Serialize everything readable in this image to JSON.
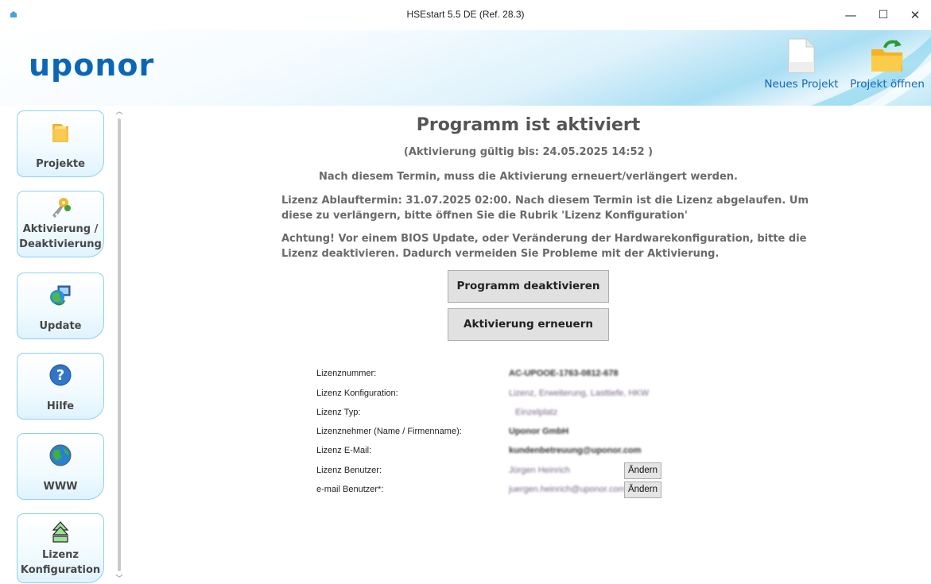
{
  "window": {
    "title": "HSEstart 5.5 DE (Ref. 28.3)",
    "minimize": "—",
    "maximize": "☐",
    "close": "✕"
  },
  "header": {
    "logo": "uponor",
    "new_project": "Neues Projekt",
    "open_project": "Projekt öffnen"
  },
  "sidebar": {
    "items": [
      {
        "label": "Projekte",
        "icon": "folder-icon"
      },
      {
        "label": "Aktivierung / Deaktivierung",
        "icon": "keys-icon"
      },
      {
        "label": "Update",
        "icon": "update-icon"
      },
      {
        "label": "Hilfe",
        "icon": "help-icon"
      },
      {
        "label": "WWW",
        "icon": "globe-icon"
      },
      {
        "label": "Lizenz Konfiguration",
        "icon": "license-config-icon"
      }
    ]
  },
  "main": {
    "heading": "Programm ist aktiviert",
    "validity": "(Aktivierung gültig bis: 24.05.2025 14:52 )",
    "renew_notice": "Nach diesem Termin, muss die Aktivierung erneuert/verlängert werden.",
    "license_expiry_1": "Lizenz Ablauftermin: 31.07.2025 02:00. Nach diesem Termin ist die Lizenz abgelaufen. Um",
    "license_expiry_2": "diese zu verlängern, bitte öffnen Sie die Rubrik 'Lizenz Konfiguration'",
    "warning_1": "Achtung! Vor einem BIOS Update, oder Veränderung der Hardwarekonfiguration, bitte die",
    "warning_2": "Lizenz deaktivieren. Dadurch vermeiden Sie Probleme mit der Aktivierung.",
    "deactivate_button": "Programm deaktivieren",
    "renew_button": "Aktivierung erneuern"
  },
  "license_info": {
    "rows": [
      {
        "label": "Lizenznummer:",
        "value": "AC-UPOOE-1763-0812-678"
      },
      {
        "label": "Lizenz Konfiguration:",
        "value": "Lizenz, Erweiterung, Lasttiefe, HKW"
      },
      {
        "label": "Lizenz Typ:",
        "value": "Einzelplatz"
      },
      {
        "label": "Lizenznehmer (Name / Firmenname):",
        "value": "Uponor GmbH"
      },
      {
        "label": "Lizenz E-Mail:",
        "value": "kundenbetreuung@uponor.com"
      },
      {
        "label": "Lizenz Benutzer:",
        "value": "Jürgen Heinrich",
        "button": "Ändern"
      },
      {
        "label": "e-mail Benutzer*:",
        "value": "juergen.heinrich@uponor.com",
        "button": "Ändern"
      }
    ]
  }
}
